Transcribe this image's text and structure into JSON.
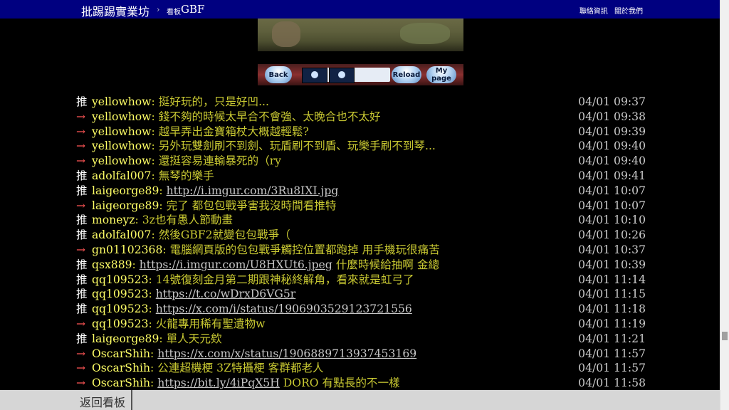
{
  "header": {
    "board_title": "批踢踢實業坊",
    "crumb_separator": "›",
    "crumb_label": "看板",
    "crumb_name": "GBF",
    "links": [
      "聯絡資訊",
      "關於我們"
    ]
  },
  "game_toolbar": {
    "back_label": "Back",
    "reload_label": "Reload",
    "mypage_label": "My page"
  },
  "comments": [
    {
      "tag": "推",
      "type": "push",
      "user": "yellowhow",
      "msg": "挺好玩的，只是好凹...",
      "link": "",
      "suffix": "",
      "time": "04/01 09:37"
    },
    {
      "tag": "→",
      "type": "arrow",
      "user": "yellowhow",
      "msg": "錢不夠的時候太早合不會強、太晚合也不太好",
      "link": "",
      "suffix": "",
      "time": "04/01 09:38"
    },
    {
      "tag": "→",
      "type": "arrow",
      "user": "yellowhow",
      "msg": "越早弄出金寶箱杖大概越輕鬆?",
      "link": "",
      "suffix": "",
      "time": "04/01 09:39"
    },
    {
      "tag": "→",
      "type": "arrow",
      "user": "yellowhow",
      "msg": "另外玩雙劍刷不到劍、玩盾刷不到盾、玩樂手刷不到琴...",
      "link": "",
      "suffix": "",
      "time": "04/01 09:40"
    },
    {
      "tag": "→",
      "type": "arrow",
      "user": "yellowhow",
      "msg": "還挺容易連輸暴死的（ry",
      "link": "",
      "suffix": "",
      "time": "04/01 09:40"
    },
    {
      "tag": "推",
      "type": "push",
      "user": "adolfal007",
      "msg": "無琴的樂手",
      "link": "",
      "suffix": "",
      "time": "04/01 09:41"
    },
    {
      "tag": "推",
      "type": "push",
      "user": "laigeorge89",
      "msg": "",
      "link": "http://i.imgur.com/3Ru8IXI.jpg",
      "suffix": "",
      "time": "04/01 10:07"
    },
    {
      "tag": "→",
      "type": "arrow",
      "user": "laigeorge89",
      "msg": "完了 都包包戰爭害我沒時間看推特",
      "link": "",
      "suffix": "",
      "time": "04/01 10:07"
    },
    {
      "tag": "推",
      "type": "push",
      "user": "moneyz",
      "msg": "3z也有愚人節動畫",
      "link": "",
      "suffix": "",
      "time": "04/01 10:10"
    },
    {
      "tag": "推",
      "type": "push",
      "user": "adolfal007",
      "msg": "然後GBF2就變包包戰爭（",
      "link": "",
      "suffix": "",
      "time": "04/01 10:26"
    },
    {
      "tag": "→",
      "type": "arrow",
      "user": "gn01102368",
      "msg": "電腦網頁版的包包戰爭觸控位置都跑掉 用手機玩很痛苦",
      "link": "",
      "suffix": "",
      "time": "04/01 10:37"
    },
    {
      "tag": "推",
      "type": "push",
      "user": "qsx889",
      "msg": "",
      "link": "https://i.imgur.com/U8HXUt6.jpeg",
      "suffix": " 什麼時候給抽啊 金總",
      "time": "04/01 10:39"
    },
    {
      "tag": "推",
      "type": "push",
      "user": "qq109523",
      "msg": "14號復刻金月第二期跟神秘終解角，看來就是虹弓了",
      "link": "",
      "suffix": "",
      "time": "04/01 11:14"
    },
    {
      "tag": "推",
      "type": "push",
      "user": "qq109523",
      "msg": "",
      "link": "https://t.co/wDrxD6VG5r",
      "suffix": "",
      "time": "04/01 11:15"
    },
    {
      "tag": "推",
      "type": "push",
      "user": "qq109523",
      "msg": "",
      "link": "https://x.com/i/status/1906903529123721556",
      "suffix": "",
      "time": "04/01 11:18"
    },
    {
      "tag": "→",
      "type": "arrow",
      "user": "qq109523",
      "msg": "火龍專用稀有聖遺物w",
      "link": "",
      "suffix": "",
      "time": "04/01 11:19"
    },
    {
      "tag": "推",
      "type": "push",
      "user": "laigeorge89",
      "msg": "單人天元欸",
      "link": "",
      "suffix": "",
      "time": "04/01 11:21"
    },
    {
      "tag": "→",
      "type": "arrow",
      "user": "OscarShih",
      "msg": "",
      "link": "https://x.com/x/status/1906889713937453169",
      "suffix": "",
      "time": "04/01 11:57"
    },
    {
      "tag": "→",
      "type": "arrow",
      "user": "OscarShih",
      "msg": "公連超機梗 3Z特攝梗  客群都老人",
      "link": "",
      "suffix": "",
      "time": "04/01 11:57"
    },
    {
      "tag": "→",
      "type": "arrow",
      "user": "OscarShih",
      "msg": "",
      "link": "https://bit.ly/4iPqX5H",
      "suffix": " DORO  有點長的不一樣",
      "time": "04/01 11:58"
    }
  ],
  "footer": {
    "back_board_label": "返回看板"
  },
  "colors": {
    "header_bg": "#000080",
    "push_user": "#ffff66",
    "push_msg": "#c8c832",
    "arrow_tag": "#ff5555"
  }
}
